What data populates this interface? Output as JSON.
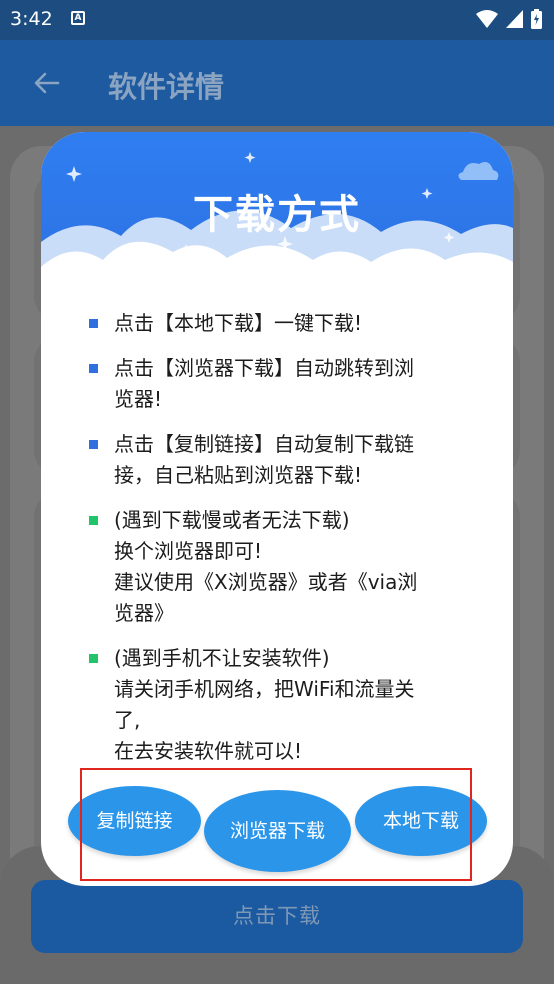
{
  "status_bar": {
    "time": "3:42",
    "notification_icon_letter": "A",
    "icons": [
      "wifi-icon",
      "signal-icon",
      "battery-icon"
    ]
  },
  "app_bar": {
    "title": "软件详情",
    "back_icon": "arrow-left-icon"
  },
  "page": {
    "download_button_label": "点击下载"
  },
  "dialog": {
    "title": "下载方式",
    "tips": [
      {
        "bullet_color": "#2f6fde",
        "lines": [
          "点击【本地下载】一键下载!"
        ]
      },
      {
        "bullet_color": "#2f6fde",
        "lines": [
          "点击【浏览器下载】自动跳转到浏",
          "览器!"
        ]
      },
      {
        "bullet_color": "#2f6fde",
        "lines": [
          "点击【复制链接】自动复制下载链",
          "接，自己粘贴到浏览器下载!"
        ]
      },
      {
        "bullet_color": "#22c46a",
        "lines": [
          "(遇到下载慢或者无法下载)",
          "换个浏览器即可!",
          "建议使用《X浏览器》或者《via浏",
          "览器》"
        ]
      },
      {
        "bullet_color": "#22c46a",
        "lines": [
          "(遇到手机不让安装软件)",
          "请关闭手机网络，把WiFi和流量关",
          "了,",
          "在去安装软件就可以!"
        ]
      }
    ],
    "buttons": {
      "copy_link": "复制链接",
      "browser_download": "浏览器下载",
      "local_download": "本地下载"
    }
  },
  "colors": {
    "header_blue": "#2e7ef0",
    "button_blue": "#2b95e9",
    "highlight_red": "#e0251f",
    "app_bar": "#1d5aa0"
  }
}
